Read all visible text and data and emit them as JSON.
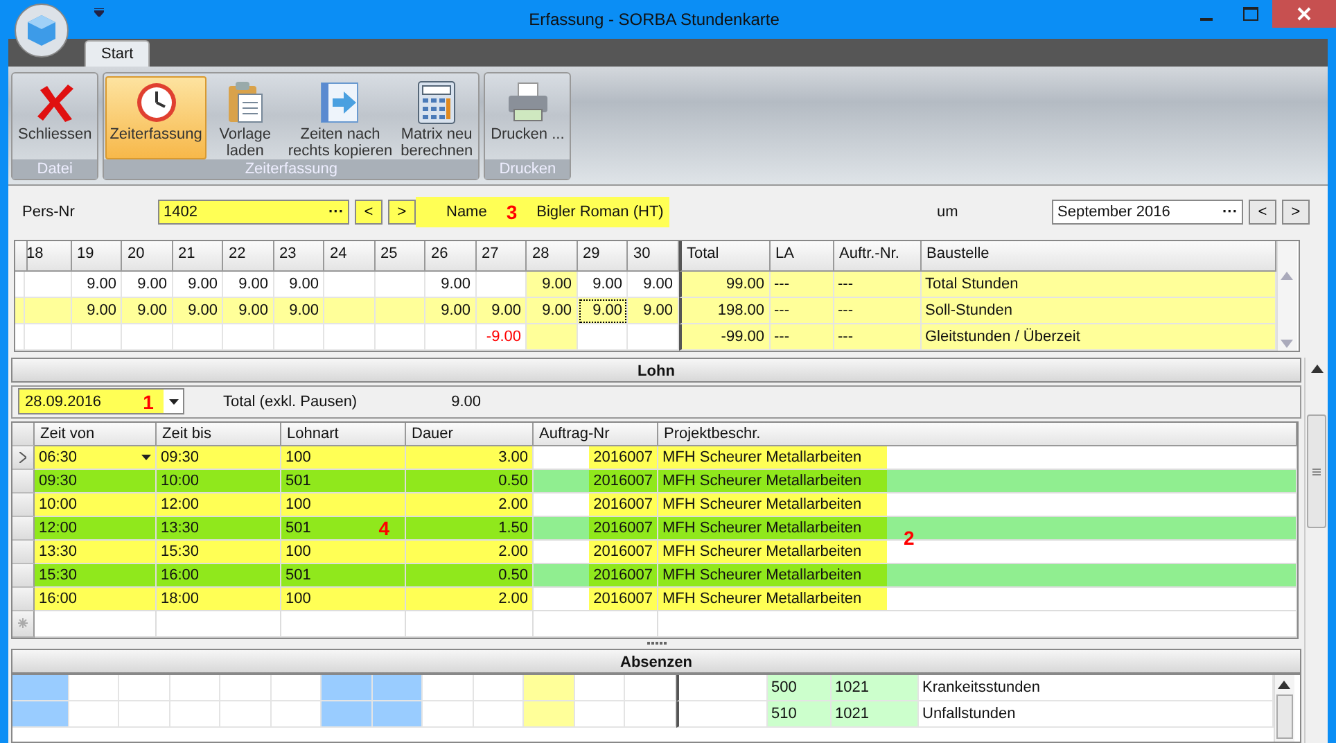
{
  "window": {
    "title": "Erfassung - SORBA Stundenkarte"
  },
  "tabs": [
    {
      "label": "Start",
      "selected": true
    }
  ],
  "ribbon": {
    "groups": [
      {
        "label": "Datei",
        "buttons": [
          {
            "kind": "close",
            "label": "Schliessen",
            "selected": false
          }
        ]
      },
      {
        "label": "Zeiterfassung",
        "buttons": [
          {
            "kind": "clock",
            "label": "Zeiterfassung",
            "selected": true
          },
          {
            "kind": "clipboard",
            "label": "Vorlage\nladen",
            "selected": false
          },
          {
            "kind": "copy",
            "label": "Zeiten nach\nrechts kopieren",
            "selected": false
          },
          {
            "kind": "calculator",
            "label": "Matrix neu\nberechnen",
            "selected": false
          }
        ]
      },
      {
        "label": "Drucken",
        "buttons": [
          {
            "kind": "printer",
            "label": "Drucken ...",
            "selected": false
          }
        ]
      }
    ]
  },
  "person": {
    "label": "Pers-Nr",
    "value": "1402",
    "picker": "···",
    "nav": [
      "<",
      ">"
    ],
    "name_label": "Name",
    "annotation": "3",
    "name": "Bigler Roman (HT)"
  },
  "month": {
    "label": "um",
    "value": "September 2016",
    "picker": "···",
    "nav": [
      "<",
      ">"
    ]
  },
  "matrix": {
    "days": [
      {
        "label": "18",
        "weekend": true,
        "highlighted": false
      },
      {
        "label": "19",
        "weekend": false,
        "highlighted": false
      },
      {
        "label": "20",
        "weekend": false,
        "highlighted": false
      },
      {
        "label": "21",
        "weekend": false,
        "highlighted": false
      },
      {
        "label": "22",
        "weekend": false,
        "highlighted": false
      },
      {
        "label": "23",
        "weekend": false,
        "highlighted": false
      },
      {
        "label": "24",
        "weekend": true,
        "highlighted": false
      },
      {
        "label": "25",
        "weekend": true,
        "highlighted": false
      },
      {
        "label": "26",
        "weekend": false,
        "highlighted": false
      },
      {
        "label": "27",
        "weekend": false,
        "highlighted": false
      },
      {
        "label": "28",
        "weekend": false,
        "highlighted": true
      },
      {
        "label": "29",
        "weekend": false,
        "highlighted": false
      },
      {
        "label": "30",
        "weekend": false,
        "highlighted": false
      }
    ],
    "summary_columns": [
      "Total",
      "LA",
      "Auftr.-Nr.",
      "Baustelle"
    ],
    "rows": [
      {
        "kind": "ist",
        "cells": [
          null,
          {
            "value": "9.00"
          },
          {
            "value": "9.00"
          },
          {
            "value": "9.00"
          },
          {
            "value": "9.00"
          },
          {
            "value": "9.00"
          },
          null,
          null,
          {
            "value": "9.00"
          },
          null,
          {
            "value": "9.00"
          },
          {
            "value": "9.00"
          },
          {
            "value": "9.00"
          }
        ],
        "total": "99.00",
        "la": "---",
        "auftrag": "---",
        "baustelle": "Total Stunden"
      },
      {
        "kind": "soll",
        "cells": [
          null,
          {
            "value": "9.00"
          },
          {
            "value": "9.00"
          },
          {
            "value": "9.00"
          },
          {
            "value": "9.00"
          },
          {
            "value": "9.00"
          },
          null,
          null,
          {
            "value": "9.00"
          },
          {
            "value": "9.00"
          },
          {
            "value": "9.00"
          },
          {
            "value": "9.00",
            "focused": true
          },
          {
            "value": "9.00"
          }
        ],
        "total": "198.00",
        "la": "---",
        "auftrag": "---",
        "baustelle": "Soll-Stunden"
      },
      {
        "kind": "diff",
        "cells": [
          null,
          null,
          null,
          null,
          null,
          null,
          null,
          null,
          null,
          {
            "value": "-9.00",
            "negative": true
          },
          null,
          null,
          null
        ],
        "total": "-99.00",
        "la": "---",
        "auftrag": "---",
        "baustelle": "Gleitstunden / Überzeit"
      }
    ]
  },
  "lohn": {
    "title": "Lohn",
    "date": "28.09.2016",
    "date_annotation": "1",
    "total_label": "Total (exkl. Pausen)",
    "total": "9.00",
    "columns": [
      "Zeit von",
      "Zeit bis",
      "Lohnart",
      "Dauer",
      "Auftrag-Nr",
      "Projektbeschr."
    ],
    "rows": [
      {
        "kind": "work",
        "selected": true,
        "von": "06:30",
        "bis": "09:30",
        "lohnart": "100",
        "dauer": "3.00",
        "auftrag": "2016007",
        "projekt": "MFH Scheurer Metallarbeiten"
      },
      {
        "kind": "pause",
        "selected": false,
        "von": "09:30",
        "bis": "10:00",
        "lohnart": "501",
        "dauer": "0.50",
        "auftrag": "2016007",
        "projekt": "MFH Scheurer Metallarbeiten"
      },
      {
        "kind": "work",
        "selected": false,
        "von": "10:00",
        "bis": "12:00",
        "lohnart": "100",
        "dauer": "2.00",
        "auftrag": "2016007",
        "projekt": "MFH Scheurer Metallarbeiten"
      },
      {
        "kind": "pause",
        "selected": false,
        "von": "12:00",
        "bis": "13:30",
        "lohnart": "501",
        "lohnart_note": "4",
        "dauer": "1.50",
        "auftrag": "2016007",
        "projekt": "MFH Scheurer Metallarbeiten",
        "projekt_note": "2"
      },
      {
        "kind": "work",
        "selected": false,
        "von": "13:30",
        "bis": "15:30",
        "lohnart": "100",
        "dauer": "2.00",
        "auftrag": "2016007",
        "projekt": "MFH Scheurer Metallarbeiten"
      },
      {
        "kind": "pause",
        "selected": false,
        "von": "15:30",
        "bis": "16:00",
        "lohnart": "501",
        "dauer": "0.50",
        "auftrag": "2016007",
        "projekt": "MFH Scheurer Metallarbeiten"
      },
      {
        "kind": "work",
        "selected": false,
        "von": "16:00",
        "bis": "18:00",
        "lohnart": "100",
        "dauer": "2.00",
        "auftrag": "2016007",
        "projekt": "MFH Scheurer Metallarbeiten"
      }
    ]
  },
  "absenzen": {
    "title": "Absenzen",
    "rows": [
      {
        "la": "500",
        "auftrag": "1021",
        "baustelle": "Krankeitsstunden"
      },
      {
        "la": "510",
        "auftrag": "1021",
        "baustelle": "Unfallstunden"
      }
    ]
  }
}
